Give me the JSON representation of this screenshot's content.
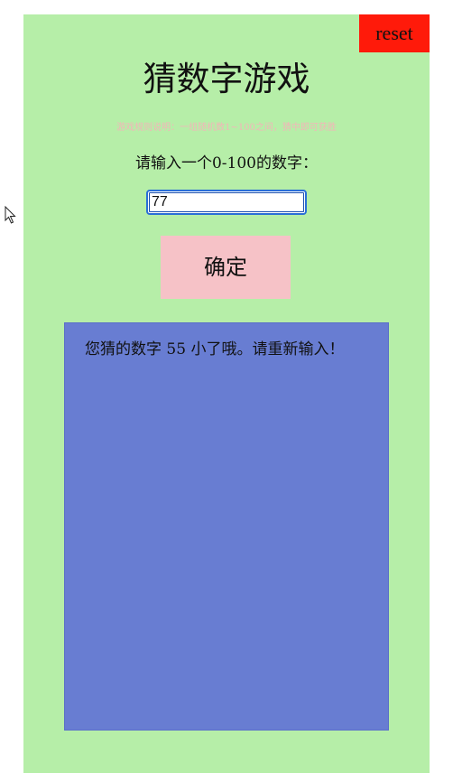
{
  "app": {
    "title": "猜数字游戏",
    "subtitle": "游戏规则说明：一组随机数1~100之间，猜中即可获胜"
  },
  "controls": {
    "reset_label": "reset",
    "prompt": "请输入一个0-100的数字：",
    "input_value": "77",
    "confirm_label": "确定"
  },
  "result": {
    "message": "您猜的数字 55 小了哦。请重新输入！"
  },
  "colors": {
    "panel_bg": "#b6eea8",
    "reset_bg": "#ff1a0a",
    "confirm_bg": "#f6c2c7",
    "result_bg": "#687dd2",
    "subtitle_text": "#f2b6b8",
    "input_border": "#2a6fd6"
  },
  "icons": {
    "pointer": "mouse-pointer-icon"
  }
}
